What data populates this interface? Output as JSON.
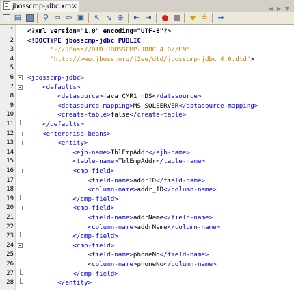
{
  "tab": {
    "title": "jbosscmp-jdbc.xml"
  },
  "toolbar": {
    "icons": [
      "source-view-icon",
      "history-icon",
      "back-icon",
      "search-icon",
      "find-prev-icon",
      "find-next-icon",
      "toggle-highlight-icon",
      "prev-bookmark-icon",
      "next-bookmark-icon",
      "toggle-bookmark-icon",
      "shift-left-icon",
      "shift-right-icon",
      "start-macro-icon",
      "stop-macro-icon",
      "check-xml-icon",
      "validate-xml-icon",
      "xsl-transform-icon"
    ]
  },
  "lines": [
    {
      "n": "1",
      "fold": "",
      "code": "<?xml version=\"1.0\" encoding=\"UTF-8\"?>"
    },
    {
      "n": "2",
      "fold": "",
      "code": "<!DOCTYPE jbosscmp-jdbc PUBLIC"
    },
    {
      "n": "3",
      "fold": "",
      "code": "      \"-//JBoss//DTD JBOSSCMP-JDBC 4.0//EN\""
    },
    {
      "n": "4",
      "fold": "",
      "code": "      \"http://www.jboss.org/j2ee/dtd/jbosscmp-jdbc_4_0.dtd\">"
    },
    {
      "n": "5",
      "fold": "",
      "code": ""
    },
    {
      "n": "6",
      "fold": "open",
      "code": "<jbosscmp-jdbc>"
    },
    {
      "n": "7",
      "fold": "open",
      "code": "    <defaults>"
    },
    {
      "n": "8",
      "fold": "",
      "code": "        <datasource>java:CMR1_nDS</datasource>"
    },
    {
      "n": "9",
      "fold": "",
      "code": "        <datasource-mapping>MS SQLSERVER</datasource-mapping>"
    },
    {
      "n": "10",
      "fold": "",
      "code": "        <create-table>false</create-table>"
    },
    {
      "n": "11",
      "fold": "end",
      "code": "    </defaults>"
    },
    {
      "n": "12",
      "fold": "open",
      "code": "    <enterprise-beans>"
    },
    {
      "n": "13",
      "fold": "open",
      "code": "        <entity>"
    },
    {
      "n": "14",
      "fold": "",
      "code": "            <ejb-name>TblEmpAddr</ejb-name>"
    },
    {
      "n": "15",
      "fold": "",
      "code": "            <table-name>TblEmpAddr</table-name>"
    },
    {
      "n": "16",
      "fold": "open",
      "code": "            <cmp-field>"
    },
    {
      "n": "17",
      "fold": "",
      "code": "                <field-name>addrID</field-name>"
    },
    {
      "n": "18",
      "fold": "",
      "code": "                <column-name>addr_ID</column-name>"
    },
    {
      "n": "19",
      "fold": "end",
      "code": "            </cmp-field>"
    },
    {
      "n": "20",
      "fold": "open",
      "code": "            <cmp-field>"
    },
    {
      "n": "21",
      "fold": "",
      "code": "                <field-name>addrName</field-name>"
    },
    {
      "n": "22",
      "fold": "",
      "code": "                <column-name>addrName</column-name>"
    },
    {
      "n": "23",
      "fold": "end",
      "code": "            </cmp-field>"
    },
    {
      "n": "24",
      "fold": "open",
      "code": "            <cmp-field>"
    },
    {
      "n": "25",
      "fold": "",
      "code": "                <field-name>phoneNo</field-name>"
    },
    {
      "n": "26",
      "fold": "",
      "code": "                <column-name>phoneNo</column-name>"
    },
    {
      "n": "27",
      "fold": "end",
      "code": "            </cmp-field>"
    },
    {
      "n": "28",
      "fold": "end",
      "code": "        </entity>"
    }
  ]
}
